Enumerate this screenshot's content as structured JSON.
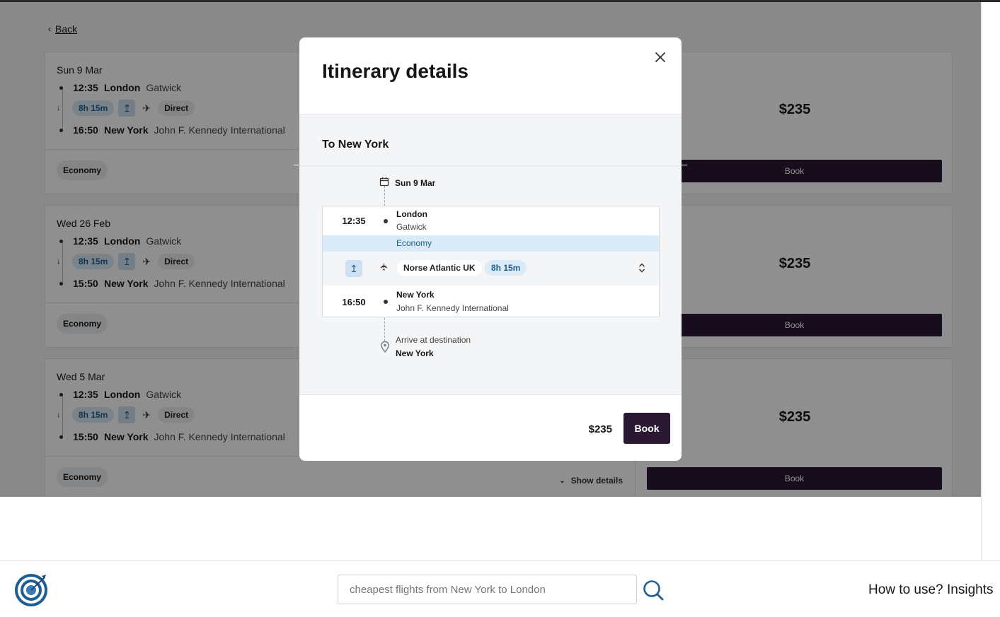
{
  "back": {
    "label": "Back"
  },
  "results": [
    {
      "date": "Sun 9 Mar",
      "dep_time": "12:35",
      "dep_city": "London",
      "dep_airport": "Gatwick",
      "duration": "8h 15m",
      "stops": "Direct",
      "arr_time": "16:50",
      "arr_city": "New York",
      "arr_airport": "John F. Kennedy International",
      "cabin": "Economy",
      "price": "$235",
      "book": "Book"
    },
    {
      "date": "Wed 26 Feb",
      "dep_time": "12:35",
      "dep_city": "London",
      "dep_airport": "Gatwick",
      "duration": "8h 15m",
      "stops": "Direct",
      "arr_time": "15:50",
      "arr_city": "New York",
      "arr_airport": "John F. Kennedy International",
      "cabin": "Economy",
      "price": "$235",
      "book": "Book"
    },
    {
      "date": "Wed 5 Mar",
      "dep_time": "12:35",
      "dep_city": "London",
      "dep_airport": "Gatwick",
      "duration": "8h 15m",
      "stops": "Direct",
      "arr_time": "15:50",
      "arr_city": "New York",
      "arr_airport": "John F. Kennedy International",
      "cabin": "Economy",
      "price": "$235",
      "book": "Book",
      "show_details": "Show details"
    }
  ],
  "modal": {
    "title": "Itinerary details",
    "section": "To New York",
    "date": "Sun 9 Mar",
    "dep_time": "12:35",
    "dep_city": "London",
    "dep_airport": "Gatwick",
    "cabin": "Economy",
    "carrier": "Norse Atlantic UK",
    "duration": "8h 15m",
    "arr_time": "16:50",
    "arr_city": "New York",
    "arr_airport": "John F. Kennedy International",
    "arrive_label": "Arrive at destination",
    "arrive_city": "New York",
    "price": "$235",
    "book": "Book"
  },
  "footer": {
    "search_placeholder": "cheapest flights from New York to London",
    "nav_how": "How to use?",
    "nav_insights": "Insights"
  },
  "colors": {
    "brand": "#2b1833",
    "accent": "#1d5f8f",
    "pill_bg": "#dbeaf7"
  },
  "icons": [
    "chevron-left-icon",
    "arrow-down-icon",
    "seat-icon",
    "plane-icon",
    "close-icon",
    "calendar-icon",
    "expand-icon",
    "location-pin-icon",
    "search-icon",
    "logo-icon"
  ]
}
